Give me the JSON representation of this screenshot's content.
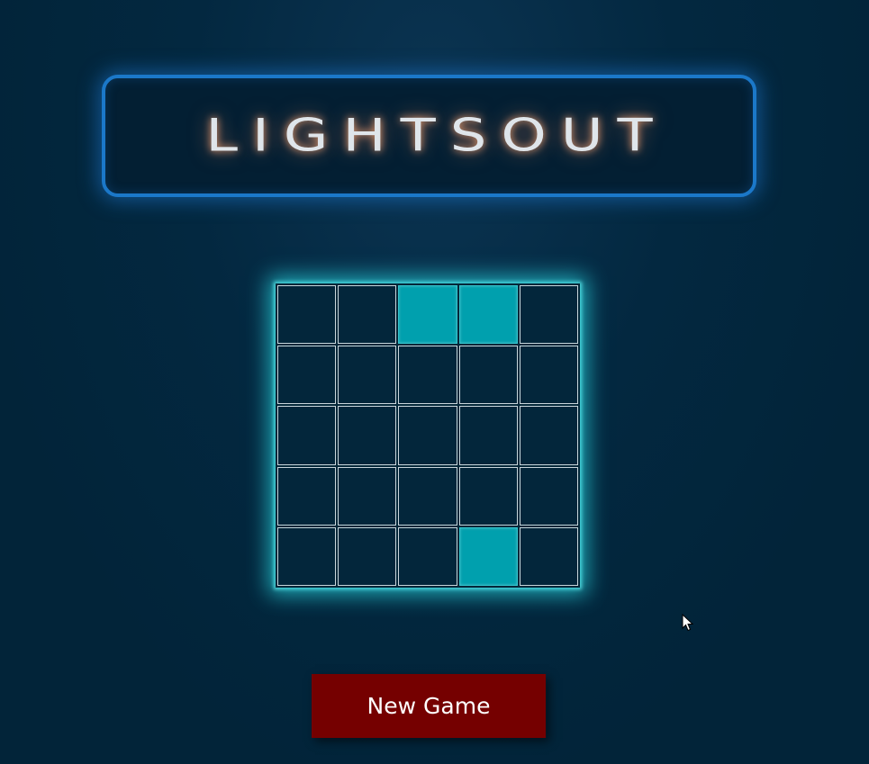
{
  "title": "LIGHTSOUT",
  "board": {
    "rows": 5,
    "cols": 5,
    "cells": [
      [
        false,
        false,
        true,
        true,
        false
      ],
      [
        false,
        false,
        false,
        false,
        false
      ],
      [
        false,
        false,
        false,
        false,
        false
      ],
      [
        false,
        false,
        false,
        false,
        false
      ],
      [
        false,
        false,
        false,
        true,
        false
      ]
    ]
  },
  "buttons": {
    "new_game_label": "New Game"
  },
  "colors": {
    "background": "#022439",
    "title_border": "#1b78c9",
    "light_on": "#00a0ae",
    "light_off": "#03263b",
    "button": "#750000"
  },
  "icons": {
    "cursor": "mouse-pointer-icon"
  }
}
